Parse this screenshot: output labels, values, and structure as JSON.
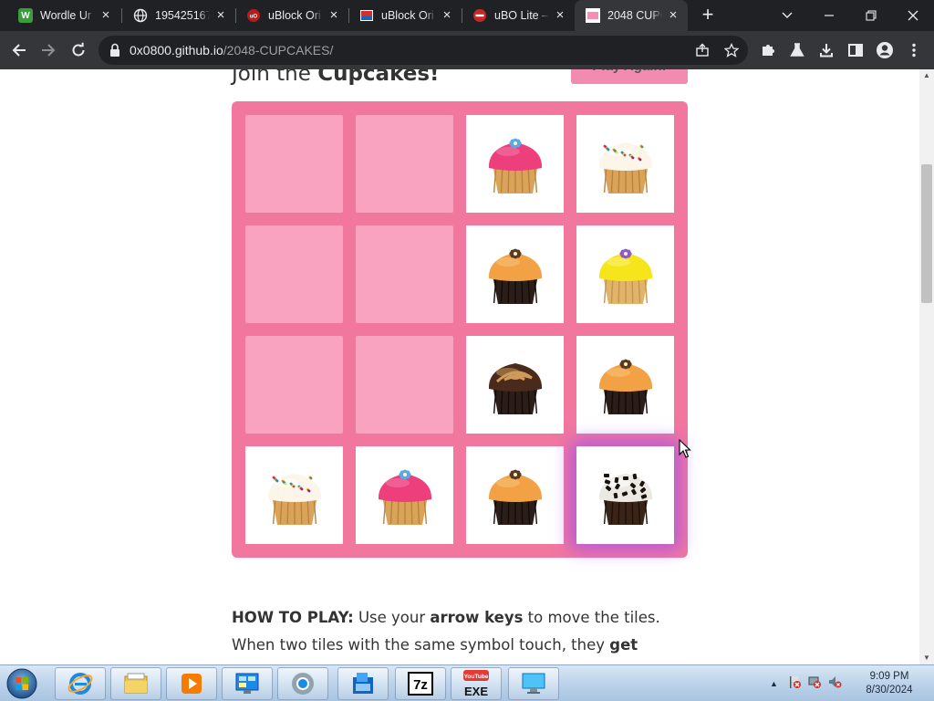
{
  "browser": {
    "tabs": [
      {
        "title": "Wordle Ur",
        "favicon": "wordle-icon",
        "favicon_letter": "W",
        "favicon_color": "#3a9c3a"
      },
      {
        "title": "195425167",
        "favicon": "globe-icon"
      },
      {
        "title": "uBlock Ori",
        "favicon": "ublock-icon",
        "favicon_color": "#b71c1c"
      },
      {
        "title": "uBlock Ori",
        "favicon": "image-icon"
      },
      {
        "title": "uBO Lite –",
        "favicon": "ubo-lite-icon",
        "favicon_color": "#c62828"
      },
      {
        "title": "2048 CUPC",
        "favicon": "cupcake-favicon",
        "active": true
      }
    ],
    "url_host": "0x0800.github.io",
    "url_path": "/2048-CUPCAKES/"
  },
  "page": {
    "heading_prefix": "Join the ",
    "heading_bold": "Cupcakes!",
    "play_again": "Play Again!",
    "howto": {
      "label": "HOW TO PLAY:",
      "t1": " Use your ",
      "b1": "arrow keys",
      "t2": " to move the tiles. When two tiles with the same symbol touch, they ",
      "b2": "get promoted!"
    }
  },
  "board": {
    "rows": 4,
    "cols": 4,
    "tiles": [
      [
        null,
        null,
        "pink-frosting",
        "white-sprinkles"
      ],
      [
        null,
        null,
        "orange-chocolate",
        "yellow-frosting"
      ],
      [
        null,
        null,
        "chocolate-swirl",
        "orange-chocolate"
      ],
      [
        "white-sprinkles",
        "pink-frosting",
        "orange-chocolate",
        "cookies-and-cream"
      ]
    ],
    "highlighted": [
      3,
      3
    ]
  },
  "colors": {
    "board": "#f2779f",
    "empty_cell": "#f9a3c0",
    "button": "#f28bb0",
    "highlight_glow": "#9b50f0"
  },
  "taskbar": {
    "items": [
      "internet-explorer-icon",
      "file-explorer-icon",
      "media-player-icon",
      "control-panel-icon",
      "chrome-icon",
      "app-window-icon",
      "7zip-icon",
      "youtube-exe-icon",
      "remote-desktop-icon"
    ],
    "labels": {
      "7zip": "7z",
      "youtube_top": "YouTube",
      "youtube_bottom": "EXE"
    },
    "time": "9:09 PM",
    "date": "8/30/2024"
  }
}
